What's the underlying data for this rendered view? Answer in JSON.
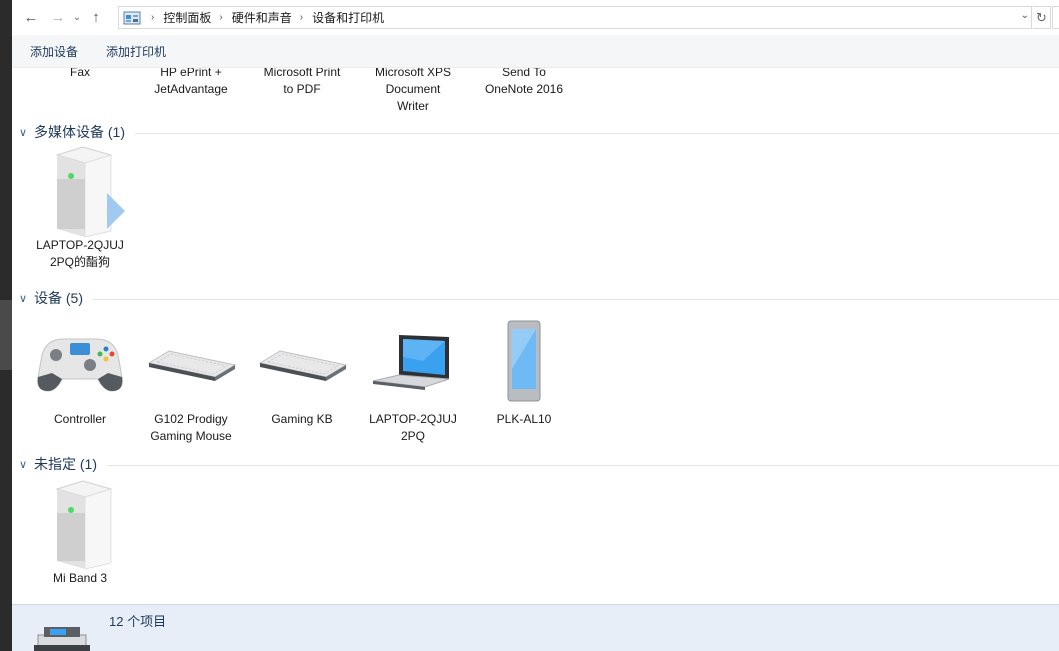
{
  "nav": {
    "back_icon": "←",
    "forward_icon": "→",
    "recent_icon": "⌄",
    "up_icon": "↑",
    "breadcrumbs": [
      "控制面板",
      "硬件和声音",
      "设备和打印机"
    ],
    "dropdown_icon": "⌄",
    "refresh_icon": "↻"
  },
  "toolbar": {
    "add_device": "添加设备",
    "add_printer": "添加打印机"
  },
  "printers_partial": [
    {
      "label": "Fax",
      "icon": "fax-icon"
    },
    {
      "label": "HP ePrint +\nJetAdvantage",
      "icon": "printer-icon"
    },
    {
      "label": "Microsoft Print\nto PDF",
      "icon": "printer-icon"
    },
    {
      "label": "Microsoft XPS\nDocument\nWriter",
      "icon": "printer-icon"
    },
    {
      "label": "Send To\nOneNote 2016",
      "icon": "printer-icon"
    }
  ],
  "groups": {
    "multimedia": {
      "title": "多媒体设备 (1)",
      "items": [
        {
          "label": "LAPTOP-2QJUJ\n2PQ的酯狗",
          "icon": "media-server-icon"
        }
      ]
    },
    "devices": {
      "title": "设备 (5)",
      "items": [
        {
          "label": "Controller",
          "icon": "gamepad-icon"
        },
        {
          "label": "G102 Prodigy\nGaming Mouse",
          "icon": "keyboard-icon"
        },
        {
          "label": "Gaming KB",
          "icon": "keyboard-icon"
        },
        {
          "label": "LAPTOP-2QJUJ\n2PQ",
          "icon": "laptop-icon"
        },
        {
          "label": "PLK-AL10",
          "icon": "phone-icon"
        }
      ]
    },
    "unspecified": {
      "title": "未指定 (1)",
      "items": [
        {
          "label": "Mi Band 3",
          "icon": "generic-device-icon"
        }
      ]
    }
  },
  "status": {
    "count": "12 个项目"
  },
  "colors": {
    "header_text": "#1e395b",
    "status_bg": "#e8eef7",
    "accent_blue": "#3b8fd9"
  }
}
